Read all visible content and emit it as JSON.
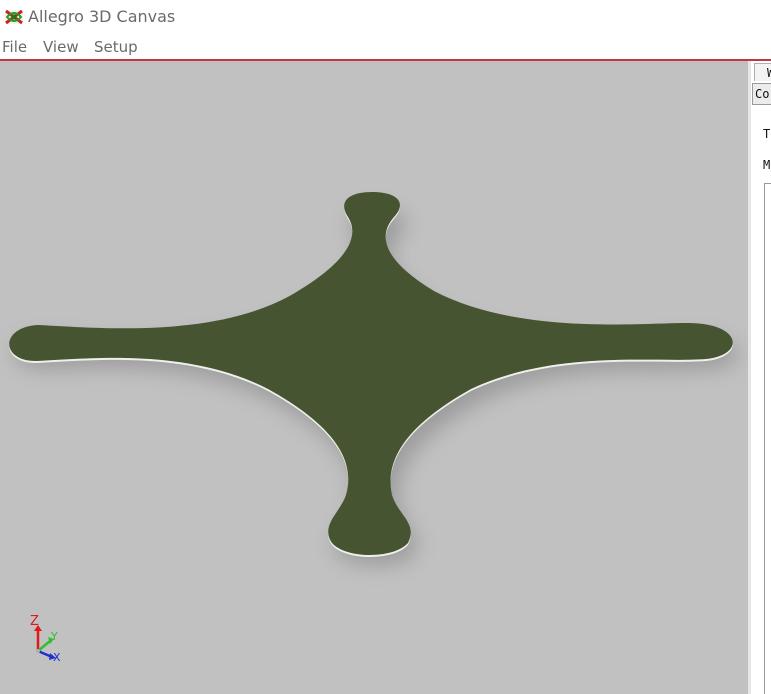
{
  "window": {
    "title": "Allegro 3D Canvas",
    "icon": "allegro-app-icon"
  },
  "menu": {
    "items": [
      "File",
      "View",
      "Setup"
    ]
  },
  "viewport": {
    "background": "#c1c1c1",
    "board_color": "#465431",
    "board_edge_color": "#f2f2f2",
    "axis": {
      "z_label": "Z",
      "y_label": "Y",
      "x_label": "X",
      "z_color": "#e01818",
      "y_color": "#2fbf2f",
      "x_color": "#2030d0"
    }
  },
  "side_panel": {
    "tab_top": "W",
    "tab_active": "Co",
    "label_1": "T",
    "label_2": "M"
  }
}
